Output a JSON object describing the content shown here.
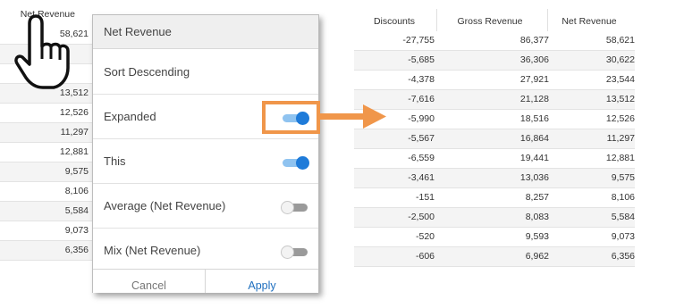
{
  "left_table": {
    "header": "Net Revenue",
    "values": [
      "58,621",
      "",
      "",
      "13,512",
      "12,526",
      "11,297",
      "12,881",
      "9,575",
      "8,106",
      "5,584",
      "9,073",
      "6,356"
    ]
  },
  "right_table": {
    "headers": [
      "Discounts",
      "Gross Revenue",
      "Net Revenue"
    ],
    "rows": [
      [
        "-27,755",
        "86,377",
        "58,621"
      ],
      [
        "-5,685",
        "36,306",
        "30,622"
      ],
      [
        "-4,378",
        "27,921",
        "23,544"
      ],
      [
        "-7,616",
        "21,128",
        "13,512"
      ],
      [
        "-5,990",
        "18,516",
        "12,526"
      ],
      [
        "-5,567",
        "16,864",
        "11,297"
      ],
      [
        "-6,559",
        "19,441",
        "12,881"
      ],
      [
        "-3,461",
        "13,036",
        "9,575"
      ],
      [
        "-151",
        "8,257",
        "8,106"
      ],
      [
        "-2,500",
        "8,083",
        "5,584"
      ],
      [
        "-520",
        "9,593",
        "9,073"
      ],
      [
        "-606",
        "6,962",
        "6,356"
      ]
    ]
  },
  "popup": {
    "title": "Net Revenue",
    "sort_label": "Sort Descending",
    "options": [
      {
        "label": "Expanded",
        "on": true
      },
      {
        "label": "This",
        "on": true
      },
      {
        "label": "Average (Net Revenue)",
        "on": false
      },
      {
        "label": "Mix (Net Revenue)",
        "on": false
      }
    ],
    "cancel_label": "Cancel",
    "apply_label": "Apply"
  },
  "colors": {
    "accent": "#1f7bd9",
    "highlight": "#f0964a",
    "apply_text": "#1f6fbf"
  },
  "icons": {
    "cursor": "hand-pointer-icon",
    "arrow": "arrow-right-icon"
  }
}
